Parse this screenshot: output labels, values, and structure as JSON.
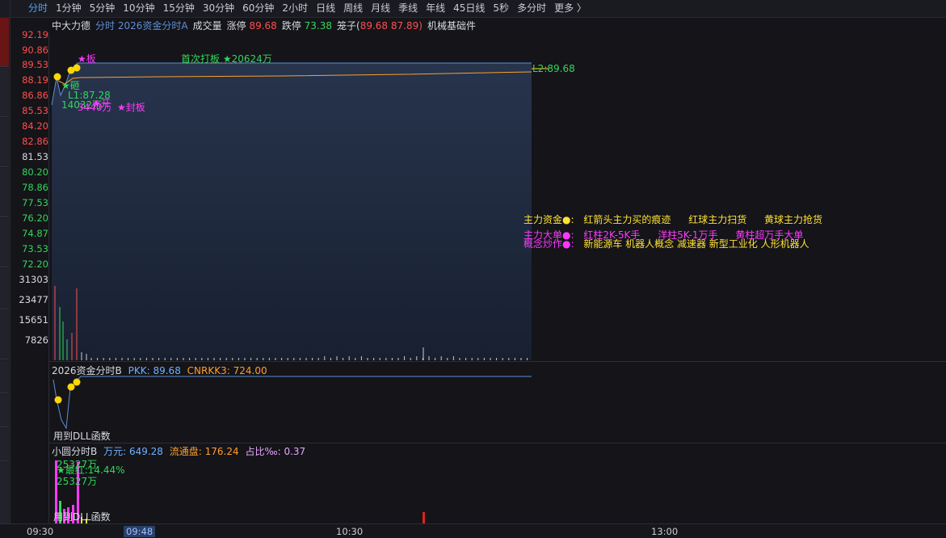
{
  "toolbar": {
    "periods": [
      "分时",
      "1分钟",
      "5分钟",
      "10分钟",
      "15分钟",
      "30分钟",
      "60分钟",
      "2小时",
      "日线",
      "周线",
      "月线",
      "季线",
      "年线",
      "45日线",
      "5秒",
      "多分时",
      "更多 〉"
    ],
    "active_index": 0
  },
  "header": {
    "stock_name": "中大力德",
    "indicator": "分时 2026资金分时A",
    "volume_label": "成交量",
    "limit_up_label": "涨停",
    "limit_up_value": "89.68",
    "limit_down_label": "跌停",
    "limit_down_value": "73.38",
    "cage_label": "笼子(",
    "cage_value1": "89.68",
    "cage_value2": "87.89)",
    "sector": "机械基础件"
  },
  "price_axis": {
    "red_ticks": [
      "92.19",
      "90.86",
      "89.53",
      "88.19",
      "86.86",
      "85.53",
      "84.20",
      "82.86"
    ],
    "mid_tick": "81.53",
    "green_ticks": [
      "80.20",
      "78.86",
      "77.53",
      "76.20",
      "74.87",
      "73.53",
      "72.20"
    ]
  },
  "volume_axis": [
    "31303",
    "23477",
    "15651",
    "7826"
  ],
  "main_annotations": {
    "first_board": "首次打板 ★20624万",
    "board_star": "★板",
    "reopen": "★砸",
    "l1": "L1:87.28",
    "amount": "14032万",
    "open_mark": "★开",
    "amount2": "3440万",
    "seal_mark": "★封板",
    "right_value": "L2:89.68"
  },
  "legend": {
    "fund_label": "主力资金●:",
    "fund_items": [
      "红箭头主力买的痕迹",
      "红球主力扫货",
      "黄球主力抢货"
    ],
    "bigorder_label": "主力大单●:",
    "bigorder_items": [
      "红柱2K-5K手",
      "洋柱5K-1万手",
      "黄柱超万手大单"
    ],
    "concept_label": "概念炒作●:",
    "concept_items": "新能源车 机器人概念 减速器 新型工业化 人形机器人"
  },
  "panel2": {
    "title": "2026资金分时B",
    "pkk_label": "PKK:",
    "pkk_value": "89.68",
    "cnrkk_label": "CNRKK3:",
    "cnrkk_value": "724.00",
    "footer": "用到DLL函数"
  },
  "panel3": {
    "title": "小圆分时B",
    "wan_label": "万元:",
    "wan_value": "649.28",
    "float_label": "流通盘:",
    "float_value": "176.24",
    "ratio_label": "占比‰:",
    "ratio_value": "0.37",
    "ann1": "25327万",
    "ann2": "★最红:14.44%",
    "ann3": "25327万",
    "footer": "用到DLL函数"
  },
  "time_axis": [
    "09:30",
    "09:48",
    "10:30",
    "13:00"
  ],
  "colors": {
    "up": "#ff4f4f",
    "down": "#33d65a",
    "price_line": "#5e8fd4",
    "avg_line": "#ff9e2c",
    "marker": "#ffd700"
  }
}
